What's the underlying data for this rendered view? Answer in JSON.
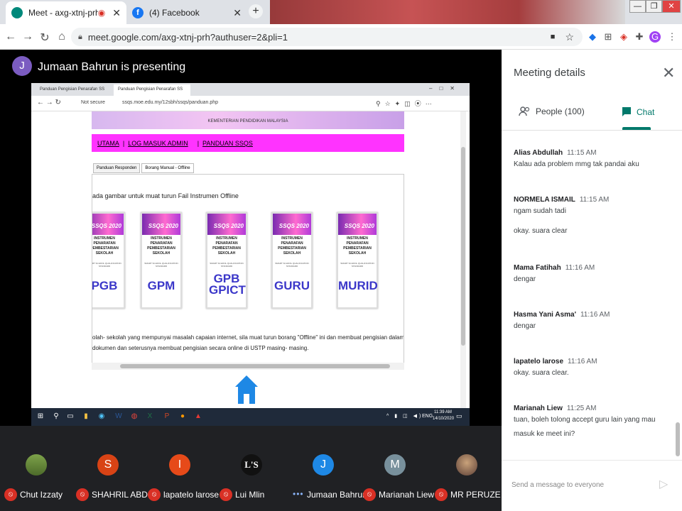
{
  "browser": {
    "tabs": [
      {
        "title": "Meet - axg-xtnj-prh",
        "favicon": "meet-icon"
      },
      {
        "title": "(4) Facebook",
        "favicon": "facebook-icon"
      }
    ],
    "url": "meet.google.com/axg-xtnj-prh?authuser=2&pli=1"
  },
  "presenter": {
    "initial": "J",
    "text": "Jumaan Bahrun is presenting"
  },
  "shared_screen": {
    "tabs": [
      "Panduan Pengisian Penarafan SS",
      "Panduan Pengisian Penarafan SS"
    ],
    "url_prefix": "Not secure",
    "url": "ssqs.moe.edu.my/12sbh/ssqs/panduan.php",
    "banner_text": "KEMENTERIAN PENDIDIKAN MALAYSIA",
    "nav": [
      "UTAMA",
      "LOG MASUK ADMIN",
      "PANDUAN SSQS"
    ],
    "inner_tabs": [
      "Panduan Responden",
      "Borang Manual - Offline"
    ],
    "intro": "ada gambar untuk muat turun Fail Instrumen Offline",
    "covers": [
      {
        "header": "SSQS 2020",
        "title": "INSTRUMEN PENARAFAN PEMBESTARIAN SEKOLAH",
        "sub": "SMART SCHOOL QUALIFICATION STANDARD",
        "code": "PGB"
      },
      {
        "header": "SSQS 2020",
        "title": "INSTRUMEN PENARAFAN PEMBESTARIAN SEKOLAH",
        "sub": "SMART SCHOOL QUALIFICATION STANDARD",
        "code": "GPM"
      },
      {
        "header": "SSQS 2020",
        "title": "INSTRUMEN PENARAFAN PEMBESTARIAN SEKOLAH",
        "sub": "SMART SCHOOL QUALIFICATION STANDARD",
        "code": "GPB GPICT"
      },
      {
        "header": "SSQS 2020",
        "title": "INSTRUMEN PENARAFAN PEMBESTARIAN SEKOLAH",
        "sub": "SMART SCHOOL QUALIFICATION STANDARD",
        "code": "GURU"
      },
      {
        "header": "SSQS 2020",
        "title": "INSTRUMEN PENARAFAN PEMBESTARIAN SEKOLAH",
        "sub": "SMART SCHOOL QUALIFICATION STANDARD",
        "code": "MURID"
      }
    ],
    "note": "olah- sekolah yang mempunyai masalah capaian internet, sila muat turun borang \"Offline\" ini dan membuat pengisian dalam\ndokumen dan seterusnya membuat pengisian secara online di USTP masing- masing.",
    "taskbar": {
      "time": "11:39 AM",
      "date": "14/10/2020",
      "lang": "ENG"
    }
  },
  "meeting_details": {
    "title": "Meeting details",
    "people_tab": "People (100)",
    "chat_tab": "Chat",
    "compose_placeholder": "Send a message to everyone"
  },
  "chat": [
    {
      "name": "Alias Abdullah",
      "time": "11:15 AM",
      "messages": [
        "Kalau ada problem mmg tak pandai aku"
      ]
    },
    {
      "name": "NORMELA ISMAIL",
      "time": "11:15 AM",
      "messages": [
        "ngam sudah tadi",
        "okay. suara clear"
      ]
    },
    {
      "name": "Mama Fatihah",
      "time": "11:16 AM",
      "messages": [
        "dengar"
      ]
    },
    {
      "name": "Hasma Yani Asma'",
      "time": "11:16 AM",
      "messages": [
        "dengar"
      ]
    },
    {
      "name": "lapatelo larose",
      "time": "11:16 AM",
      "messages": [
        "okay. suara clear."
      ]
    },
    {
      "name": "Marianah Liew",
      "time": "11:25 AM",
      "messages": [
        "tuan, boleh tolong  accept guru lain yang mau masuk ke meet ini?"
      ]
    }
  ],
  "participants": [
    {
      "name": "Chut Izzaty",
      "initial": "",
      "color": "#6b8e3d",
      "status": "muted"
    },
    {
      "name": "SHAHRIL ABD...",
      "initial": "S",
      "color": "#d84315",
      "status": "muted"
    },
    {
      "name": "lapatelo larose",
      "initial": "I",
      "color": "#e64a19",
      "status": "muted"
    },
    {
      "name": "Lui Mlin",
      "initial": "L'S",
      "color": "#111111",
      "status": "muted"
    },
    {
      "name": "Jumaan Bahrun",
      "initial": "J",
      "color": "#1e88e5",
      "status": "speaking"
    },
    {
      "name": "Marianah Liew",
      "initial": "M",
      "color": "#78909c",
      "status": "muted"
    },
    {
      "name": "MR PERUZE",
      "initial": "",
      "color": "#8d6e63",
      "status": "muted"
    }
  ]
}
